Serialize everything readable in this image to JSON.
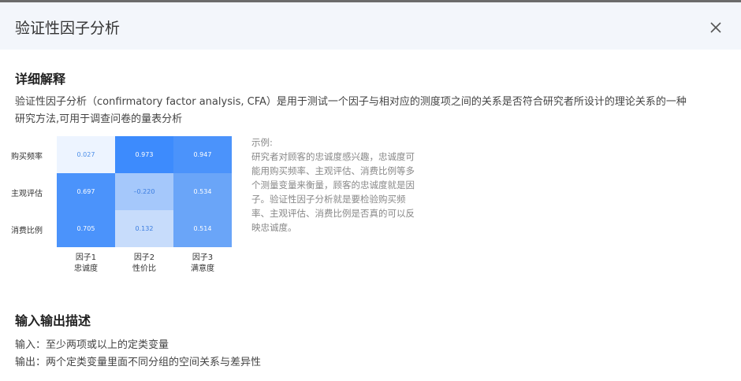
{
  "dialog": {
    "title": "验证性因子分析"
  },
  "explain": {
    "heading": "详细解释",
    "body_line1": "验证性因子分析（confirmatory factor analysis, CFA）是用于测试一个因子与相对应的测度项之间的关系是否符合研究者所设计的理论关系的一种",
    "body_line2": "研究方法,可用于调查问卷的量表分析"
  },
  "chart_data": {
    "type": "heatmap",
    "rows": [
      "购买频率",
      "主观评估",
      "消费比例"
    ],
    "columns": [
      {
        "line1": "因子1",
        "line2": "忠诚度"
      },
      {
        "line1": "因子2",
        "line2": "性价比"
      },
      {
        "line1": "因子3",
        "line2": "满意度"
      }
    ],
    "values": [
      [
        "0.027",
        "0.973",
        "0.947"
      ],
      [
        "0.697",
        "–0.220",
        "0.534"
      ],
      [
        "0.705",
        "0.132",
        "0.514"
      ]
    ],
    "colors": [
      [
        "#edf4ff",
        "#3d8bfd",
        "#4b93fb"
      ],
      [
        "#4b93fb",
        "#a5c8fb",
        "#6aa5f8"
      ],
      [
        "#4b93fb",
        "#c7dcfb",
        "#6aa5f8"
      ]
    ],
    "text_colors": [
      [
        "#4a8de8",
        "#ffffff",
        "#ffffff"
      ],
      [
        "#ffffff",
        "#3b7de0",
        "#ffffff"
      ],
      [
        "#ffffff",
        "#3b7de0",
        "#ffffff"
      ]
    ]
  },
  "example": {
    "label": "示例:",
    "lines": [
      "研究者对顾客的忠诚度感兴趣，忠诚度可",
      "能用购买频率、主观评估、消费比例等多",
      "个测量变量来衡量，顾客的忠诚度就是因",
      "子。验证性因子分析就是要检验购买频",
      "率、主观评估、消费比例是否真的可以反",
      "映忠诚度。"
    ]
  },
  "io": {
    "heading": "输入输出描述",
    "input": "输入：至少两项或以上的定类变量",
    "output": "输出：两个定类变量里面不同分组的空间关系与差异性"
  }
}
